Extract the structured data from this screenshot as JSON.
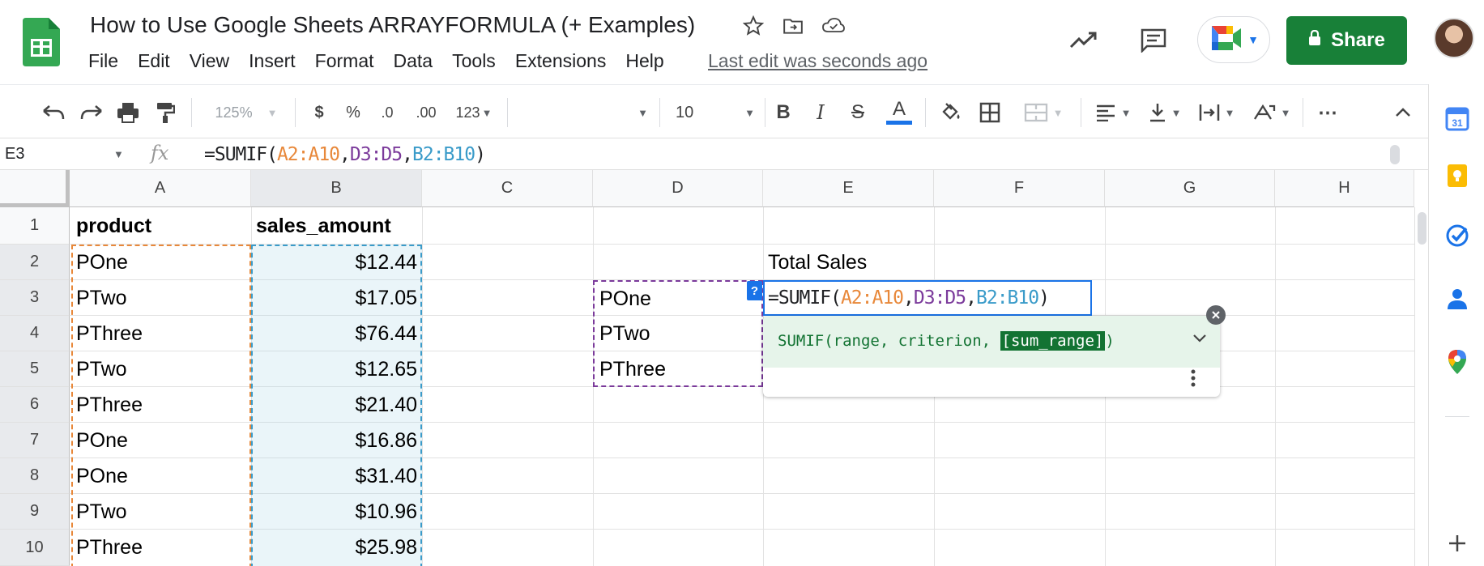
{
  "doc": {
    "title": "How to Use Google Sheets ARRAYFORMULA (+ Examples)",
    "last_edit": "Last edit was seconds ago"
  },
  "menu": [
    "File",
    "Edit",
    "View",
    "Insert",
    "Format",
    "Data",
    "Tools",
    "Extensions",
    "Help"
  ],
  "share": {
    "label": "Share"
  },
  "toolbar": {
    "zoom": "125%",
    "currency": "$",
    "percent": "%",
    "dec_decrease": ".0",
    "dec_increase": ".00",
    "more_formats": "123",
    "font_size": "10",
    "bold": "B",
    "italic": "I",
    "strike": "S",
    "text_color": "A",
    "more": "⋯"
  },
  "formula_bar": {
    "cell_ref": "E3",
    "fx": "fx",
    "formula": {
      "prefix": "=SUMIF(",
      "arg1": "A2:A10",
      "sep1": ",",
      "arg2": "D3:D5",
      "sep2": ",",
      "arg3": "B2:B10",
      "suffix": ")"
    }
  },
  "columns": [
    "A",
    "B",
    "C",
    "D",
    "E",
    "F",
    "G",
    "H"
  ],
  "rows": [
    "1",
    "2",
    "3",
    "4",
    "5",
    "6",
    "7",
    "8",
    "9",
    "10"
  ],
  "cells": {
    "A": [
      "product",
      "POne",
      "PTwo",
      "PThree",
      "PTwo",
      "PThree",
      "POne",
      "POne",
      "PTwo",
      "PThree"
    ],
    "B": [
      "sales_amount",
      "$12.44",
      "$17.05",
      "$76.44",
      "$12.65",
      "$21.40",
      "$16.86",
      "$31.40",
      "$10.96",
      "$25.98"
    ],
    "D": [
      "POne",
      "PTwo",
      "PThree"
    ],
    "E2": "Total Sales"
  },
  "edit_cell": {
    "help": "?"
  },
  "tooltip": {
    "sig_prefix": "SUMIF(range, criterion, ",
    "sig_highlight": "[sum_range]",
    "sig_suffix": ")"
  },
  "colors": {
    "range_a": "#e8883a",
    "range_b": "#3a9bc9",
    "range_d": "#7b3a9b",
    "share_bg": "#188038",
    "accent": "#1a73e8"
  }
}
